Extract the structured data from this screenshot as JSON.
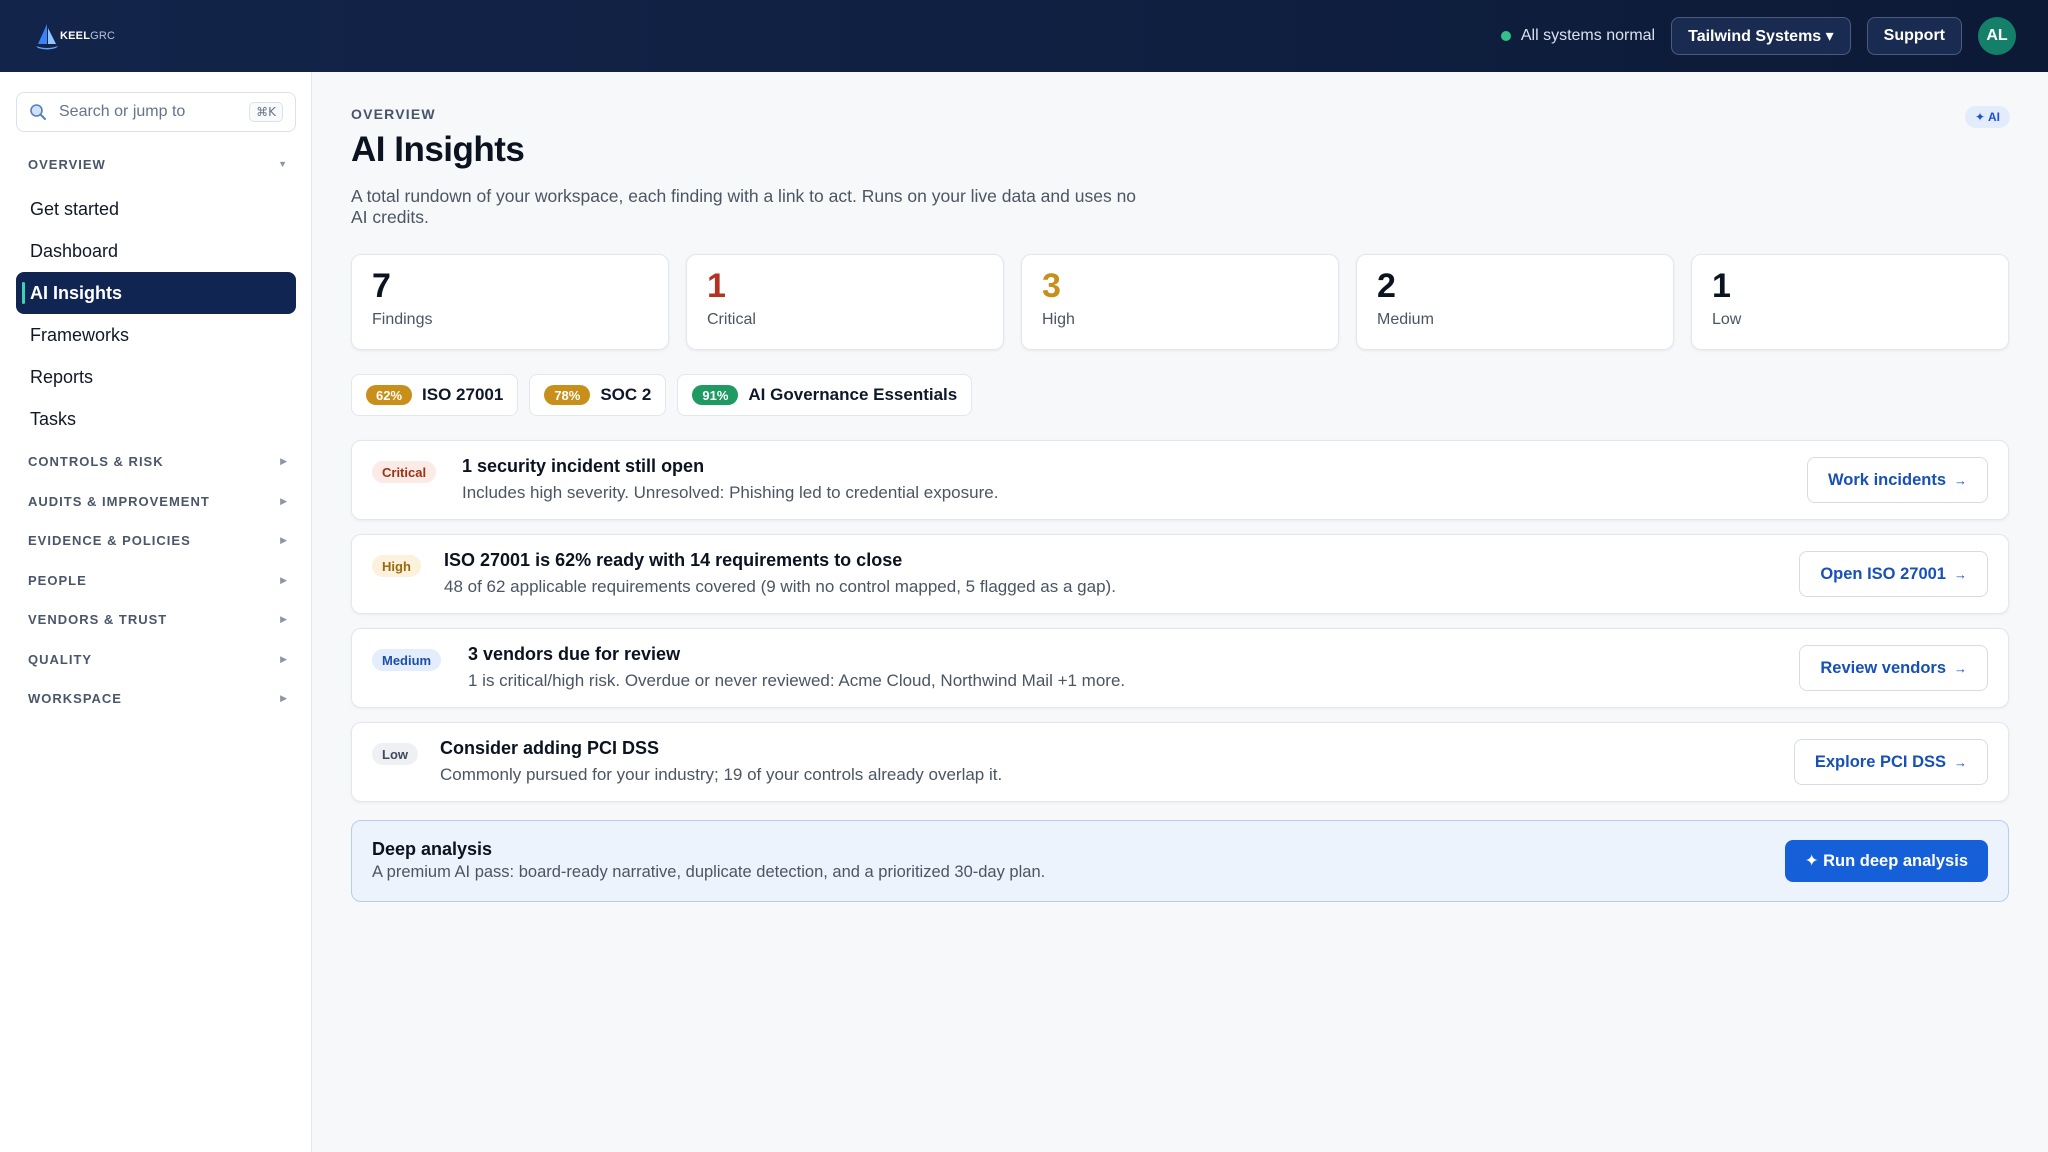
{
  "topbar": {
    "brand_primary": "KEEL",
    "brand_secondary": "GRC",
    "status_text": "All systems normal",
    "org_label": "Tailwind Systems ▾",
    "support_label": "Support",
    "avatar_initials": "AL"
  },
  "sidebar": {
    "search_placeholder": "Search or jump to",
    "search_shortcut": "⌘K",
    "overview_label": "OVERVIEW",
    "items": [
      {
        "label": "Get started"
      },
      {
        "label": "Dashboard"
      },
      {
        "label": "AI Insights"
      },
      {
        "label": "Frameworks"
      },
      {
        "label": "Reports"
      },
      {
        "label": "Tasks"
      }
    ],
    "sections": [
      {
        "label": "CONTROLS & RISK"
      },
      {
        "label": "AUDITS & IMPROVEMENT"
      },
      {
        "label": "EVIDENCE & POLICIES"
      },
      {
        "label": "PEOPLE"
      },
      {
        "label": "VENDORS & TRUST"
      },
      {
        "label": "QUALITY"
      },
      {
        "label": "WORKSPACE"
      }
    ]
  },
  "main": {
    "eyebrow": "OVERVIEW",
    "ai_chip": "✦ AI",
    "title": "AI Insights",
    "subtitle": "A total rundown of your workspace, each finding with a link to act. Runs on your live data and uses no AI credits.",
    "stats": [
      {
        "value": "7",
        "label": "Findings",
        "color": "#0b1220"
      },
      {
        "value": "1",
        "label": "Critical",
        "color": "#b4321f"
      },
      {
        "value": "3",
        "label": "High",
        "color": "#c8901a"
      },
      {
        "value": "2",
        "label": "Medium",
        "color": "#0b1220"
      },
      {
        "value": "1",
        "label": "Low",
        "color": "#0b1220"
      }
    ],
    "frameworks": [
      {
        "pct": "62%",
        "name": "ISO 27001",
        "color": "#c8901a"
      },
      {
        "pct": "78%",
        "name": "SOC 2",
        "color": "#c8901a"
      },
      {
        "pct": "91%",
        "name": "AI Governance Essentials",
        "color": "#1f9a63"
      }
    ],
    "findings": [
      {
        "severity": "Critical",
        "title": "1 security incident still open",
        "desc": "Includes high severity. Unresolved: Phishing led to credential exposure.",
        "action": "Work incidents"
      },
      {
        "severity": "High",
        "title": "ISO 27001 is 62% ready with 14 requirements to close",
        "desc": "48 of 62 applicable requirements covered (9 with no control mapped, 5 flagged as a gap).",
        "action": "Open ISO 27001"
      },
      {
        "severity": "Medium",
        "title": "3 vendors due for review",
        "desc": "1 is critical/high risk. Overdue or never reviewed: Acme Cloud, Northwind Mail +1 more.",
        "action": "Review vendors"
      },
      {
        "severity": "Low",
        "title": "Consider adding PCI DSS",
        "desc": "Commonly pursued for your industry; 19 of your controls already overlap it.",
        "action": "Explore PCI DSS"
      }
    ],
    "deep": {
      "title": "Deep analysis",
      "desc": "A premium AI pass: board-ready narrative, duplicate detection, and a prioritized 30-day plan.",
      "action": "✦ Run deep analysis"
    },
    "arrow": "→"
  }
}
